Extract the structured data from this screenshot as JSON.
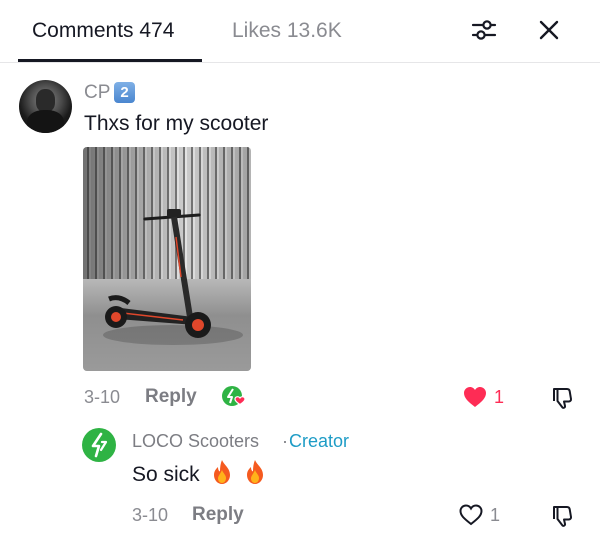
{
  "header": {
    "tab_comments": "Comments 474",
    "tab_likes": "Likes 13.6K",
    "filter_icon": "sliders-icon",
    "close_icon": "close-icon"
  },
  "comment": {
    "author": "CP",
    "badge": "2",
    "text": "Thxs for my scooter",
    "image_alt": "electric scooter in front of slatted wall",
    "date": "3-10",
    "reply_label": "Reply",
    "likes": "1",
    "liked": true,
    "creator_liked": true
  },
  "reply": {
    "author": "LOCO Scooters",
    "separator": "·",
    "tag": "Creator",
    "text": "So sick",
    "emoji": [
      "fire-emoji",
      "fire-emoji"
    ],
    "date": "3-10",
    "reply_label": "Reply",
    "likes": "1",
    "liked": false
  },
  "colors": {
    "like_red": "#fe2c55",
    "creator_green": "#2fb344",
    "creator_blue": "#1e9cc6",
    "muted": "#8a8b91"
  }
}
